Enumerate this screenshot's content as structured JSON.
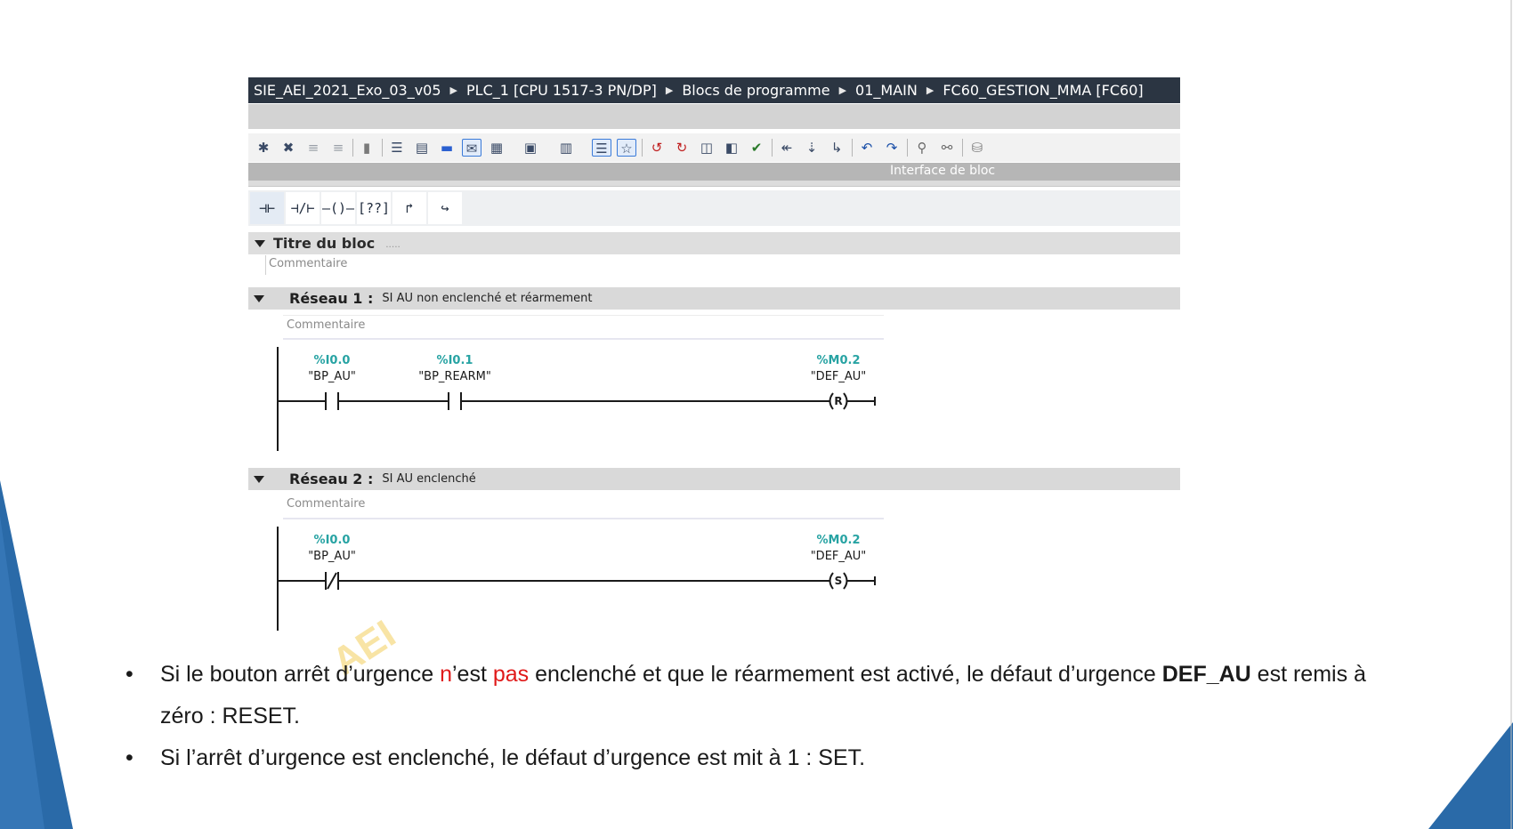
{
  "breadcrumb": {
    "items": [
      "SIE_AEI_2021_Exo_03_v05",
      "PLC_1 [CPU 1517-3 PN/DP]",
      "Blocs de programme",
      "01_MAIN",
      "FC60_GESTION_MMA [FC60]"
    ]
  },
  "interface": {
    "label": "Interface de bloc"
  },
  "toolbar_icons": [
    "insert-network-icon",
    "delete-network-icon",
    "insert-row-icon",
    "add-row-icon",
    "db-access-icon",
    "list-view-icon",
    "absolute-operands-icon",
    "symbolic-operands-icon",
    "comment-view-icon",
    "favorites-icon",
    "favorites-toggle-icon",
    "network-comments-icon",
    "expand-icon",
    "monitor-icon",
    "collapse-icon",
    "go-to-error-icon",
    "go-to-previous-icon",
    "go-to-next-icon",
    "compare-icon",
    "update-icon",
    "download-icon",
    "network-up-icon",
    "network-down-icon",
    "network-jump-icon",
    "step-into-icon",
    "step-out-icon",
    "inspect-icon",
    "zoom-icon",
    "db-icon"
  ],
  "ladder_toolbar": {
    "buttons": [
      {
        "icon": "no-contact-icon",
        "glyph": "⊣⊢"
      },
      {
        "icon": "nc-contact-icon",
        "glyph": "⊣/⊢"
      },
      {
        "icon": "coil-icon",
        "glyph": "–()–"
      },
      {
        "icon": "empty-box-icon",
        "glyph": "[??]"
      },
      {
        "icon": "open-branch-icon",
        "glyph": "↱"
      },
      {
        "icon": "close-branch-icon",
        "glyph": "↪"
      }
    ]
  },
  "block": {
    "title": "Titre du bloc",
    "title_dots": ".....",
    "comment": "Commentaire"
  },
  "networks": [
    {
      "title": "Réseau 1 :",
      "description": "SI AU non enclenché et réarmement",
      "comment": "Commentaire",
      "contacts": [
        {
          "address": "%I0.0",
          "symbol": "\"BP_AU\"",
          "type": "NO"
        },
        {
          "address": "%I0.1",
          "symbol": "\"BP_REARM\"",
          "type": "NO"
        }
      ],
      "coil": {
        "address": "%M0.2",
        "symbol": "\"DEF_AU\"",
        "type": "R"
      }
    },
    {
      "title": "Réseau 2 :",
      "description": "SI AU enclenché",
      "comment": "Commentaire",
      "contacts": [
        {
          "address": "%I0.0",
          "symbol": "\"BP_AU\"",
          "type": "NC"
        }
      ],
      "coil": {
        "address": "%M0.2",
        "symbol": "\"DEF_AU\"",
        "type": "S"
      }
    }
  ],
  "bullets": [
    {
      "parts": [
        {
          "text": "Si le bouton arrêt d’urgence ",
          "style": ""
        },
        {
          "text": "n",
          "style": "red"
        },
        {
          "text": "’est ",
          "style": ""
        },
        {
          "text": "pas",
          "style": "red"
        },
        {
          "text": " enclenché et que le réarmement est activé, le défaut d’urgence ",
          "style": ""
        },
        {
          "text": "DEF_AU",
          "style": "bold"
        },
        {
          "text": " est remis à zéro : RESET.",
          "style": ""
        }
      ]
    },
    {
      "parts": [
        {
          "text": "Si l’arrêt d’urgence est enclenché, le défaut d’urgence est mit à 1 : SET.",
          "style": ""
        }
      ]
    }
  ],
  "bullet_symbol": "•",
  "watermark": "AEI",
  "colors": {
    "breadcrumb_bg": "#2b3542",
    "address_teal": "#27a3a3",
    "highlight_red": "#e01a1a",
    "deco_blue": "#2a6aa8"
  }
}
